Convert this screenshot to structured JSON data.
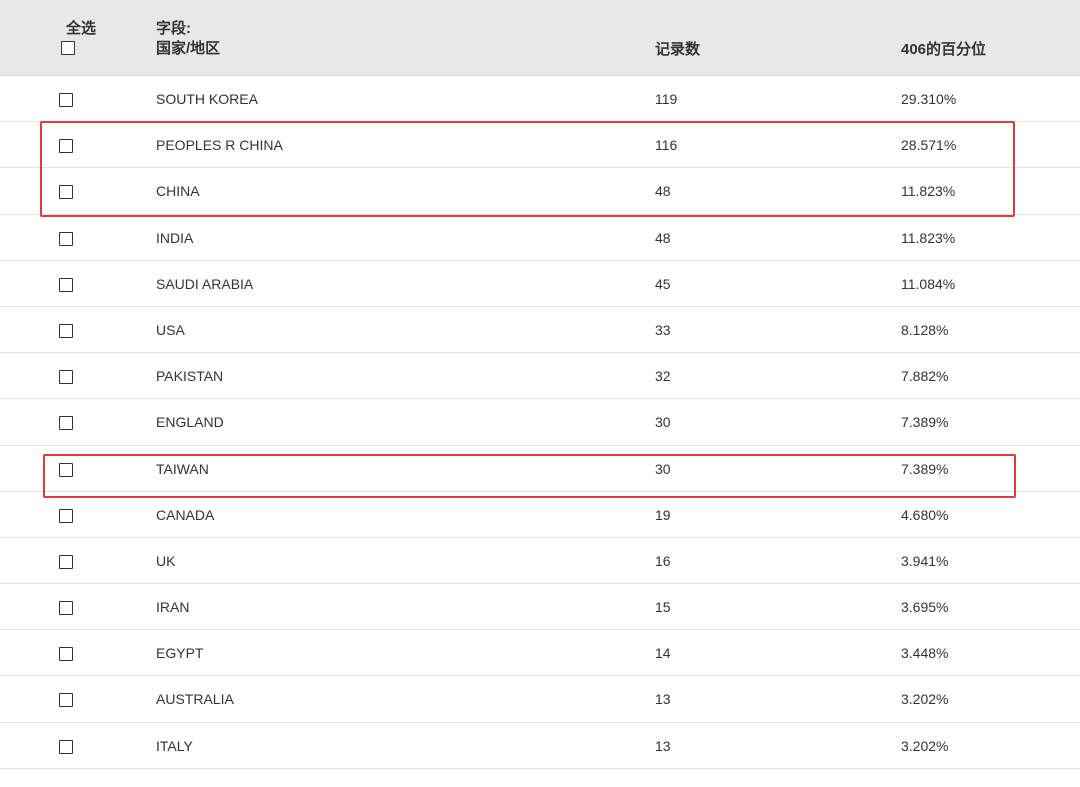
{
  "header": {
    "select_all_label": "全选",
    "field_caption": "字段:",
    "field_name": "国家/地区",
    "count_label": "记录数",
    "percent_label": "406的百分位"
  },
  "rows": [
    {
      "name": "SOUTH KOREA",
      "count": "119",
      "percent": "29.310%"
    },
    {
      "name": "PEOPLES R CHINA",
      "count": "116",
      "percent": "28.571%"
    },
    {
      "name": "CHINA",
      "count": "48",
      "percent": "11.823%"
    },
    {
      "name": "INDIA",
      "count": "48",
      "percent": "11.823%"
    },
    {
      "name": "SAUDI ARABIA",
      "count": "45",
      "percent": "11.084%"
    },
    {
      "name": "USA",
      "count": "33",
      "percent": "8.128%"
    },
    {
      "name": "PAKISTAN",
      "count": "32",
      "percent": "7.882%"
    },
    {
      "name": "ENGLAND",
      "count": "30",
      "percent": "7.389%"
    },
    {
      "name": "TAIWAN",
      "count": "30",
      "percent": "7.389%"
    },
    {
      "name": "CANADA",
      "count": "19",
      "percent": "4.680%"
    },
    {
      "name": "UK",
      "count": "16",
      "percent": "3.941%"
    },
    {
      "name": "IRAN",
      "count": "15",
      "percent": "3.695%"
    },
    {
      "name": "EGYPT",
      "count": "14",
      "percent": "3.448%"
    },
    {
      "name": "AUSTRALIA",
      "count": "13",
      "percent": "3.202%"
    },
    {
      "name": "ITALY",
      "count": "13",
      "percent": "3.202%"
    }
  ],
  "colors": {
    "header_background": "#e8e8e8",
    "highlight_border": "#e23b3b",
    "row_divider": "#e2e2e2"
  }
}
